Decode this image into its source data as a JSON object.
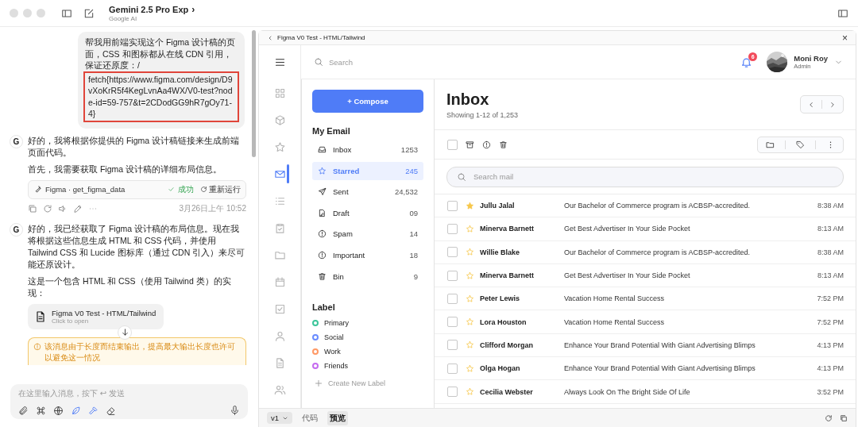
{
  "window": {
    "title": "Gemini 2.5 Pro Exp",
    "subtitle": "Google AI",
    "chevron": "›"
  },
  "chat": {
    "user_message": {
      "text": "帮我用前端实现这个 Figma 设计稿的页面，CSS 和图标都从在线 CDN 引用，保证还原度：/",
      "link": "fetch{https://www.figma.com/design/D9vXoKrR5f4KegLvnAa4WX/V0-test?node-id=59-757&t=2CDodGG9hR7gOy71-4}"
    },
    "replies": [
      {
        "avatar": "G",
        "items": [
          {
            "kind": "paragraph",
            "text": "好的，我将根据你提供的 Figma 设计稿链接来生成前端页面代码。"
          },
          {
            "kind": "paragraph",
            "text": "首先，我需要获取 Figma 设计稿的详细布局信息。"
          },
          {
            "kind": "tool",
            "name": "Figma · get_figma_data",
            "status": "成功",
            "rerun": "重新运行"
          },
          {
            "kind": "actions",
            "timestamp": "3月26日上午 10:52"
          }
        ]
      },
      {
        "avatar": "G",
        "items": [
          {
            "kind": "paragraph",
            "text": "好的，我已经获取了 Figma 设计稿的布局信息。现在我将根据这些信息生成 HTML 和 CSS 代码，并使用 Tailwind CSS 和 Lucide 图标库（通过 CDN 引入）来尽可能还原设计。"
          },
          {
            "kind": "paragraph",
            "text": "这是一个包含 HTML 和 CSS（使用 Tailwind 类）的实现："
          },
          {
            "kind": "artifact",
            "title": "Figma V0 Test - HTML/Tailwind",
            "hint": "Click to open"
          },
          {
            "kind": "warning",
            "text": "该消息由于长度而结束输出，提高最大输出长度也许可以避免这一情况"
          }
        ]
      }
    ],
    "input": {
      "placeholder": "在这里输入消息，按下 ↩ 发送",
      "tools": [
        {
          "kind": "paperclip",
          "on": false
        },
        {
          "kind": "command",
          "on": false
        },
        {
          "kind": "globe",
          "on": false
        },
        {
          "kind": "leaf",
          "on": true
        },
        {
          "kind": "hammer",
          "on": true
        },
        {
          "kind": "eraser",
          "on": false
        }
      ]
    }
  },
  "preview": {
    "title": "Figma V0 Test - HTML/Tailwind",
    "close": "×",
    "rail": [
      {
        "kind": "grid",
        "selected": false
      },
      {
        "kind": "box",
        "selected": false
      },
      {
        "kind": "star",
        "selected": false
      },
      {
        "kind": "mail",
        "selected": true
      },
      {
        "kind": "list",
        "selected": false
      },
      {
        "kind": "clipboard",
        "selected": false
      },
      {
        "kind": "folder",
        "selected": false
      },
      {
        "kind": "calendar",
        "selected": false
      },
      {
        "kind": "checkbox",
        "selected": false
      },
      {
        "kind": "user",
        "selected": false
      },
      {
        "kind": "file",
        "selected": false
      },
      {
        "kind": "users",
        "selected": false
      }
    ],
    "search": {
      "placeholder": "Search"
    },
    "notifications": "6",
    "user": {
      "name": "Moni Roy",
      "role": "Admin"
    },
    "compose": "+ Compose",
    "my_email": "My Email",
    "folders": [
      {
        "kind": "inbox",
        "label": "Inbox",
        "count": "1253",
        "selected": false
      },
      {
        "kind": "star",
        "label": "Starred",
        "count": "245",
        "selected": true
      },
      {
        "kind": "send",
        "label": "Sent",
        "count": "24,532",
        "selected": false
      },
      {
        "kind": "draft",
        "label": "Draft",
        "count": "09",
        "selected": false
      },
      {
        "kind": "alert",
        "label": "Spam",
        "count": "14",
        "selected": false
      },
      {
        "kind": "alert",
        "label": "Important",
        "count": "18",
        "selected": false
      },
      {
        "kind": "trash",
        "label": "Bin",
        "count": "9",
        "selected": false
      }
    ],
    "label_heading": "Label",
    "labels": [
      {
        "name": "Primary",
        "color": "#3cc59a"
      },
      {
        "name": "Social",
        "color": "#6a8cff"
      },
      {
        "name": "Work",
        "color": "#ff9966"
      },
      {
        "name": "Friends",
        "color": "#c56cf0"
      }
    ],
    "create_label": "Create New Label",
    "inbox": {
      "title": "Inbox",
      "showing": "Showing 1-12 of 1,253",
      "select_all": {
        "checked": false
      },
      "search_placeholder": "Search mail",
      "rows": [
        {
          "sender": "Jullu Jalal",
          "subject": "Our Bachelor of Commerce program is ACBSP-accredited.",
          "time": "8:38 AM",
          "starred": true,
          "checked": false
        },
        {
          "sender": "Minerva Barnett",
          "subject": "Get Best Advertiser In Your Side Pocket",
          "time": "8:13 AM",
          "starred": false,
          "checked": false
        },
        {
          "sender": "Willie Blake",
          "subject": "Our Bachelor of Commerce program is ACBSP-accredited.",
          "time": "8:38 AM",
          "starred": false,
          "checked": false
        },
        {
          "sender": "Minerva Barnett",
          "subject": "Get Best Advertiser In Your Side Pocket",
          "time": "8:13 AM",
          "starred": false,
          "checked": false
        },
        {
          "sender": "Peter Lewis",
          "subject": "Vacation Home Rental Success",
          "time": "7:52 PM",
          "starred": false,
          "checked": false
        },
        {
          "sender": "Lora Houston",
          "subject": "Vacation Home Rental Success",
          "time": "7:52 PM",
          "starred": false,
          "checked": false
        },
        {
          "sender": "Clifford Morgan",
          "subject": "Enhance Your Brand Potential With Giant Advertising Blimps",
          "time": "4:13 PM",
          "starred": false,
          "checked": false
        },
        {
          "sender": "Olga Hogan",
          "subject": "Enhance Your Brand Potential With Giant Advertising Blimps",
          "time": "4:13 PM",
          "starred": false,
          "checked": false
        },
        {
          "sender": "Cecilia Webster",
          "subject": "Always Look On The Bright Side Of Life",
          "time": "3:52 PM",
          "starred": false,
          "checked": false
        }
      ]
    },
    "bottom": {
      "version": "v1",
      "tabs": [
        {
          "label": "代码",
          "selected": false
        },
        {
          "label": "预览",
          "selected": true
        }
      ]
    }
  }
}
